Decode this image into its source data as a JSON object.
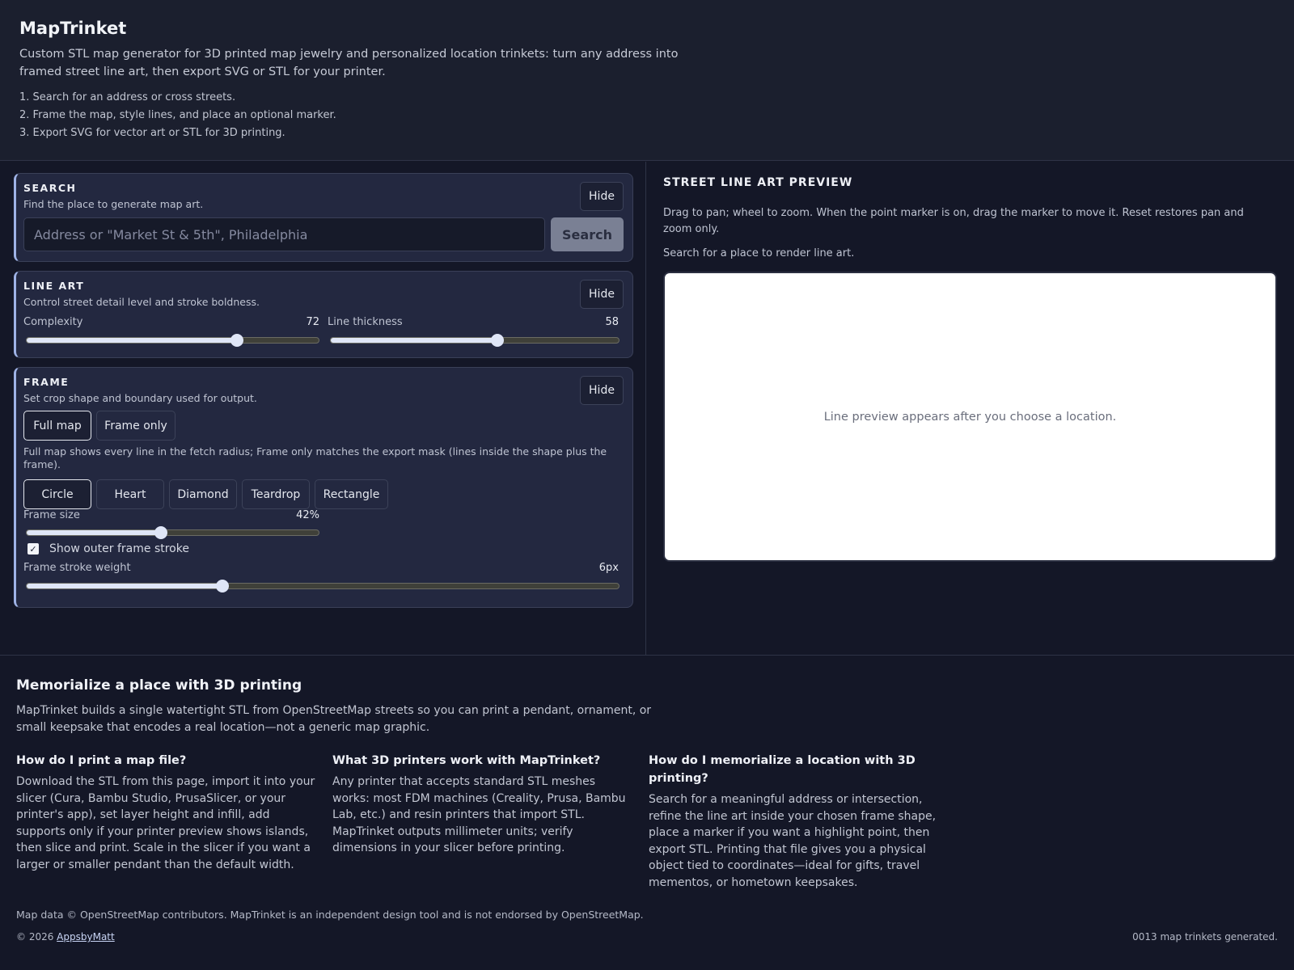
{
  "header": {
    "title": "MapTrinket",
    "tagline": "Custom STL map generator for 3D printed map jewelry and personalized location trinkets: turn any address into framed street line art, then export SVG or STL for your printer.",
    "steps": [
      "1. Search for an address or cross streets.",
      "2. Frame the map, style lines, and place an optional marker.",
      "3. Export SVG for vector art or STL for 3D printing."
    ]
  },
  "search": {
    "title": "SEARCH",
    "subtitle": "Find the place to generate map art.",
    "hide_label": "Hide",
    "input_value": "",
    "placeholder": "Address or \"Market St & 5th\", Philadelphia",
    "button_label": "Search"
  },
  "line_art": {
    "title": "LINE ART",
    "subtitle": "Control street detail level and stroke boldness.",
    "hide_label": "Hide",
    "complexity_label": "Complexity",
    "complexity_value": "72",
    "complexity_fraction": 0.72,
    "thickness_label": "Line thickness",
    "thickness_value": "58",
    "thickness_fraction": 0.58
  },
  "frame": {
    "title": "FRAME",
    "subtitle": "Set crop shape and boundary used for output.",
    "hide_label": "Hide",
    "modes": [
      "Full map",
      "Frame only"
    ],
    "active_mode": "Full map",
    "note": "Full map shows every line in the fetch radius; Frame only matches the export mask (lines inside the shape plus the frame).",
    "shapes": [
      "Circle",
      "Heart",
      "Diamond",
      "Teardrop",
      "Rectangle"
    ],
    "active_shape": "Circle",
    "size_label": "Frame size",
    "size_value": "42%",
    "size_fraction": 0.46,
    "outer_stroke_label": "Show outer frame stroke",
    "outer_stroke_checked": true,
    "stroke_weight_label": "Frame stroke weight",
    "stroke_weight_value": "6px",
    "stroke_weight_fraction": 0.33
  },
  "preview": {
    "title": "STREET LINE ART PREVIEW",
    "help": "Drag to pan; wheel to zoom. When the point marker is on, drag the marker to move it. Reset restores pan and zoom only.",
    "status": "Search for a place to render line art.",
    "placeholder": "Line preview appears after you choose a location."
  },
  "info": {
    "title": "Memorialize a place with 3D printing",
    "lead": "MapTrinket builds a single watertight STL from OpenStreetMap streets so you can print a pendant, ornament, or small keepsake that encodes a real location—not a generic map graphic.",
    "faqs": [
      {
        "q": "How do I print a map file?",
        "a": "Download the STL from this page, import it into your slicer (Cura, Bambu Studio, PrusaSlicer, or your printer's app), set layer height and infill, add supports only if your printer preview shows islands, then slice and print. Scale in the slicer if you want a larger or smaller pendant than the default width."
      },
      {
        "q": "What 3D printers work with MapTrinket?",
        "a": "Any printer that accepts standard STL meshes works: most FDM machines (Creality, Prusa, Bambu Lab, etc.) and resin printers that import STL. MapTrinket outputs millimeter units; verify dimensions in your slicer before printing."
      },
      {
        "q": "How do I memorialize a location with 3D printing?",
        "a": "Search for a meaningful address or intersection, refine the line art inside your chosen frame shape, place a marker if you want a highlight point, then export STL. Printing that file gives you a physical object tied to coordinates—ideal for gifts, travel mementos, or hometown keepsakes."
      }
    ]
  },
  "footer": {
    "note": "Map data © OpenStreetMap contributors. MapTrinket is an independent design tool and is not endorsed by OpenStreetMap.",
    "copyright_prefix": "© 2026 ",
    "author_link": "AppsbyMatt",
    "counter": "0013 map trinkets generated."
  }
}
